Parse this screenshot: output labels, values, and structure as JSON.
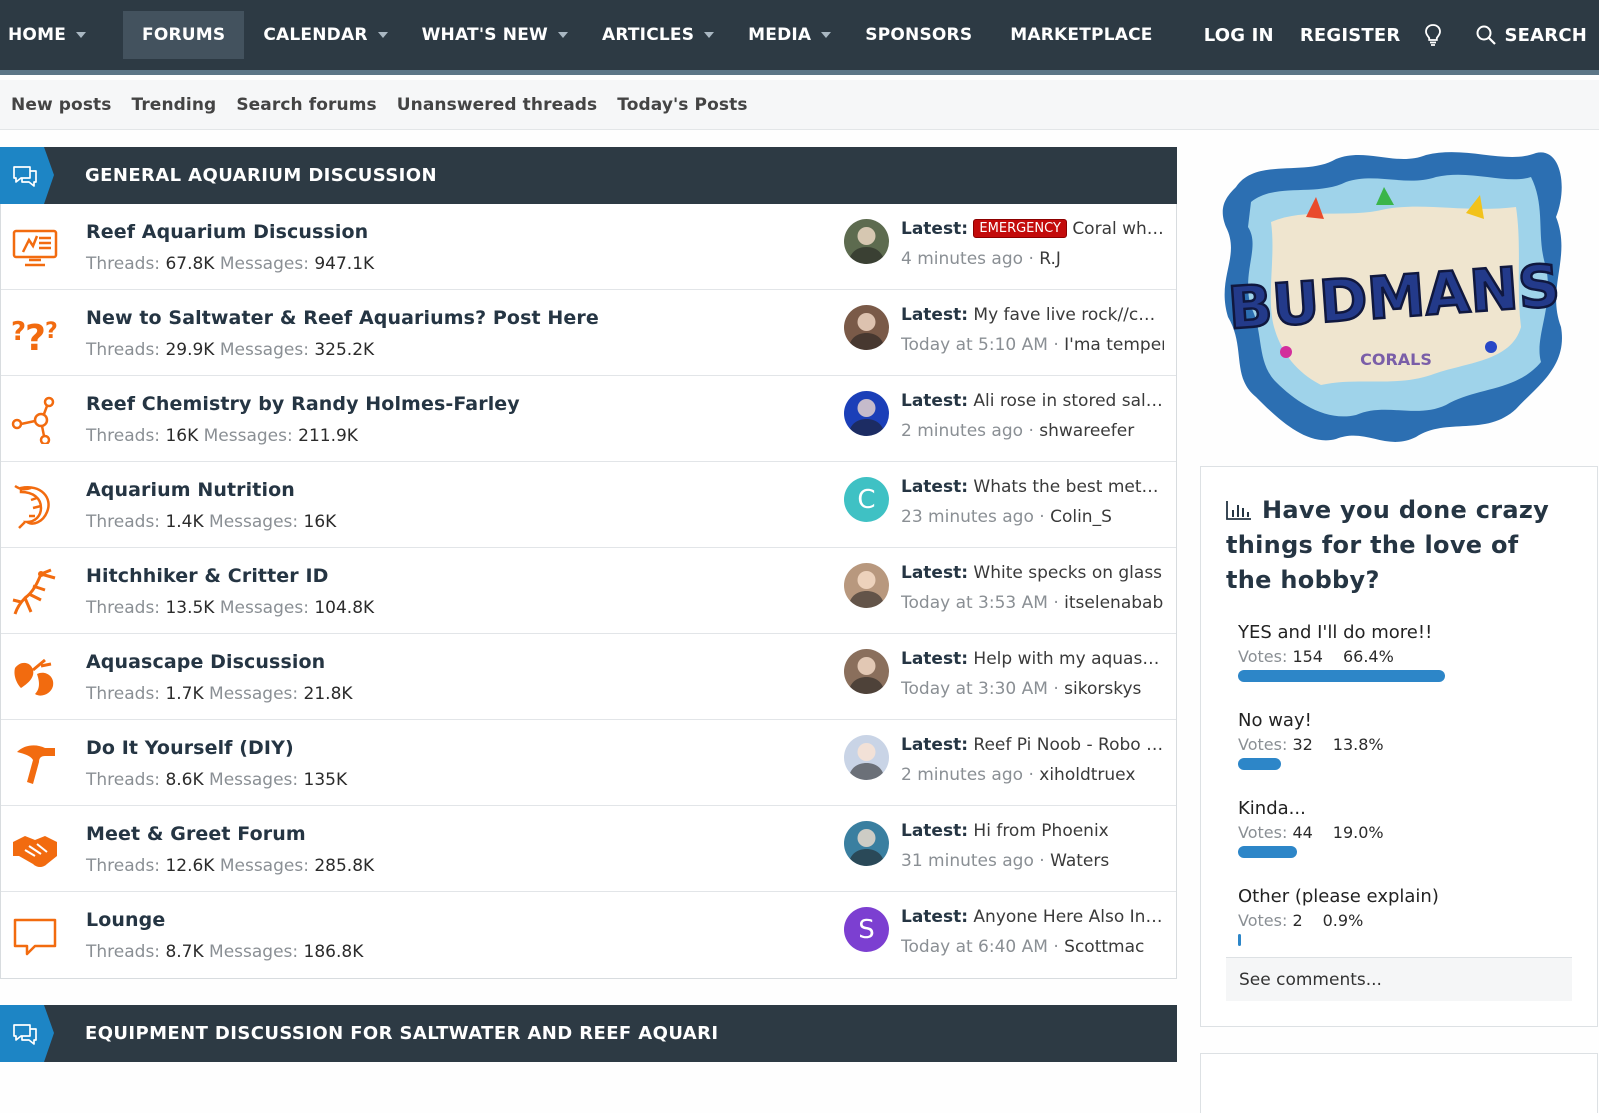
{
  "topnav": {
    "items": [
      {
        "label": "HOME",
        "caret": true
      },
      {
        "label": "FORUMS",
        "caret": false,
        "active": true
      },
      {
        "label": "CALENDAR",
        "caret": true
      },
      {
        "label": "WHAT'S NEW",
        "caret": true
      },
      {
        "label": "ARTICLES",
        "caret": true
      },
      {
        "label": "MEDIA",
        "caret": true
      },
      {
        "label": "SPONSORS",
        "caret": false
      },
      {
        "label": "MARKETPLACE",
        "caret": false
      }
    ],
    "login": "LOG IN",
    "register": "REGISTER",
    "search": "SEARCH"
  },
  "subnav": [
    "New posts",
    "Trending",
    "Search forums",
    "Unanswered threads",
    "Today's Posts"
  ],
  "categories": [
    {
      "title": "GENERAL AQUARIUM DISCUSSION",
      "nodes": [
        {
          "title": "Reef Aquarium Discussion",
          "threads": "67.8K",
          "messages": "947.1K",
          "latest_prefix": "EMERGENCY",
          "latest_title": "Coral whit...",
          "time": "4 minutes ago",
          "user": "R.J",
          "icon": "monitor-icon",
          "avatar": "photo",
          "avatar_color": "#5d6b4f"
        },
        {
          "title": "New to Saltwater & Reef Aquariums? Post Here",
          "threads": "29.9K",
          "messages": "325.2K",
          "latest_prefix": "",
          "latest_title": "My fave live rock//coral...",
          "time": "Today at 5:10 AM",
          "user": "I'ma temperm",
          "icon": "question-marks-icon",
          "avatar": "photo",
          "avatar_color": "#7a5a48"
        },
        {
          "title": "Reef Chemistry by Randy Holmes-Farley",
          "threads": "16K",
          "messages": "211.9K",
          "latest_prefix": "",
          "latest_title": "Ali rose in stored saltw...",
          "time": "2 minutes ago",
          "user": "shwareefer",
          "icon": "molecule-icon",
          "avatar": "photo",
          "avatar_color": "#1b3fb8"
        },
        {
          "title": "Aquarium Nutrition",
          "threads": "1.4K",
          "messages": "16K",
          "latest_prefix": "",
          "latest_title": "Whats the best metho...",
          "time": "23 minutes ago",
          "user": "Colin_S",
          "icon": "shrimp-icon",
          "avatar": "C",
          "avatar_color": "#3fc1c4"
        },
        {
          "title": "Hitchhiker & Critter ID",
          "threads": "13.5K",
          "messages": "104.8K",
          "latest_prefix": "",
          "latest_title": "White specks on glass",
          "time": "Today at 3:53 AM",
          "user": "itselenababe",
          "icon": "critter-icon",
          "avatar": "photo",
          "avatar_color": "#b8987e"
        },
        {
          "title": "Aquascape Discussion",
          "threads": "1.7K",
          "messages": "21.8K",
          "latest_prefix": "",
          "latest_title": "Help with my aquascape",
          "time": "Today at 3:30 AM",
          "user": "sikorskys",
          "icon": "hands-icon",
          "avatar": "photo",
          "avatar_color": "#8a6f5c"
        },
        {
          "title": "Do It Yourself (DIY)",
          "threads": "8.6K",
          "messages": "135K",
          "latest_prefix": "",
          "latest_title": "Reef Pi Noob - Robo Ta...",
          "time": "2 minutes ago",
          "user": "xiholdtruex",
          "icon": "hammer-icon",
          "avatar": "photo",
          "avatar_color": "#c9d4e6"
        },
        {
          "title": "Meet & Greet Forum",
          "threads": "12.6K",
          "messages": "285.8K",
          "latest_prefix": "",
          "latest_title": "Hi from Phoenix",
          "time": "31 minutes ago",
          "user": "Waters",
          "icon": "handshake-icon",
          "avatar": "photo",
          "avatar_color": "#3a7fa0"
        },
        {
          "title": "Lounge",
          "threads": "8.7K",
          "messages": "186.8K",
          "latest_prefix": "",
          "latest_title": "Anyone Here Also Into ...",
          "time": "Today at 6:40 AM",
          "user": "Scottmac",
          "icon": "chat-box-icon",
          "avatar": "S",
          "avatar_color": "#7c3fd1"
        }
      ]
    },
    {
      "title": "EQUIPMENT DISCUSSION FOR SALTWATER AND REEF AQUARI",
      "nodes": []
    }
  ],
  "labels": {
    "threads": "Threads:",
    "messages": "Messages:",
    "latest": "Latest:",
    "votes": "Votes:"
  },
  "poll": {
    "question": "Have you done crazy things for the love of the hobby?",
    "options": [
      {
        "label": "YES and I'll do more!!",
        "votes": "154",
        "percent": "66.4%",
        "fraction": 0.664
      },
      {
        "label": "No way!",
        "votes": "32",
        "percent": "13.8%",
        "fraction": 0.138
      },
      {
        "label": "Kinda...",
        "votes": "44",
        "percent": "19.0%",
        "fraction": 0.19
      },
      {
        "label": "Other (please explain)",
        "votes": "2",
        "percent": "0.9%",
        "fraction": 0.009
      }
    ],
    "see_comments": "See comments..."
  },
  "sponsor": {
    "logo_text": "BUDMANS",
    "logo_subtext": "CORALS"
  },
  "colors": {
    "nav_bg": "#2d3a44",
    "accent_blue": "#1d85c5",
    "icon_orange": "#f26b0f",
    "emergency_red": "#c30b0b",
    "poll_bar": "#2d86c8"
  }
}
